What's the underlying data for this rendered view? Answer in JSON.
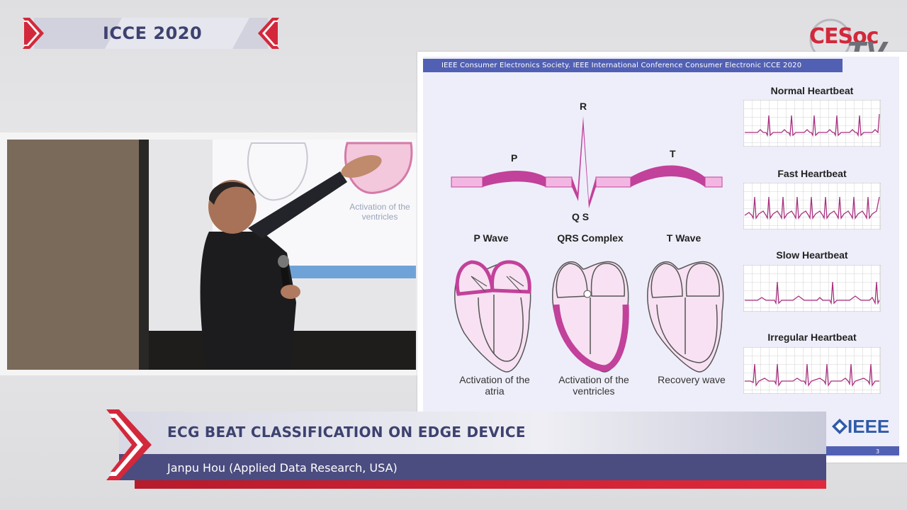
{
  "banner": {
    "title": "ICCE 2020"
  },
  "logo": {
    "line1": "CESoc",
    "line2": "TV"
  },
  "video": {
    "screen_caption_line1": "Activation of the",
    "screen_caption_line2": "ventricles"
  },
  "slide": {
    "header": "IEEE Consumer Electronics Society. IEEE International Conference Consumer Electronic ICCE 2020",
    "wave_labels": {
      "p": "P",
      "r": "R",
      "t": "T",
      "qs": "Q S"
    },
    "hearts": [
      {
        "title": "P Wave",
        "caption_line1": "Activation of the",
        "caption_line2": "atria"
      },
      {
        "title": "QRS Complex",
        "caption_line1": "Activation of the",
        "caption_line2": "ventricles"
      },
      {
        "title": "T Wave",
        "caption_line1": "Recovery wave",
        "caption_line2": ""
      }
    ],
    "rhythms": [
      {
        "title": "Normal Heartbeat"
      },
      {
        "title": "Fast Heartbeat"
      },
      {
        "title": "Slow Heartbeat"
      },
      {
        "title": "Irregular Heartbeat"
      }
    ],
    "ieee_logo": "IEEE",
    "page_number": "3",
    "colors": {
      "wave": "#c2419a",
      "wave_light": "#f3b6e2",
      "header": "#5260b4"
    }
  },
  "lower_third": {
    "title": "ECG BEAT CLASSIFICATION ON EDGE DEVICE",
    "subtitle": "Janpu Hou (Applied Data Research, USA)",
    "colors": {
      "accent": "#d3283b",
      "bar": "#4b4c7f"
    }
  }
}
